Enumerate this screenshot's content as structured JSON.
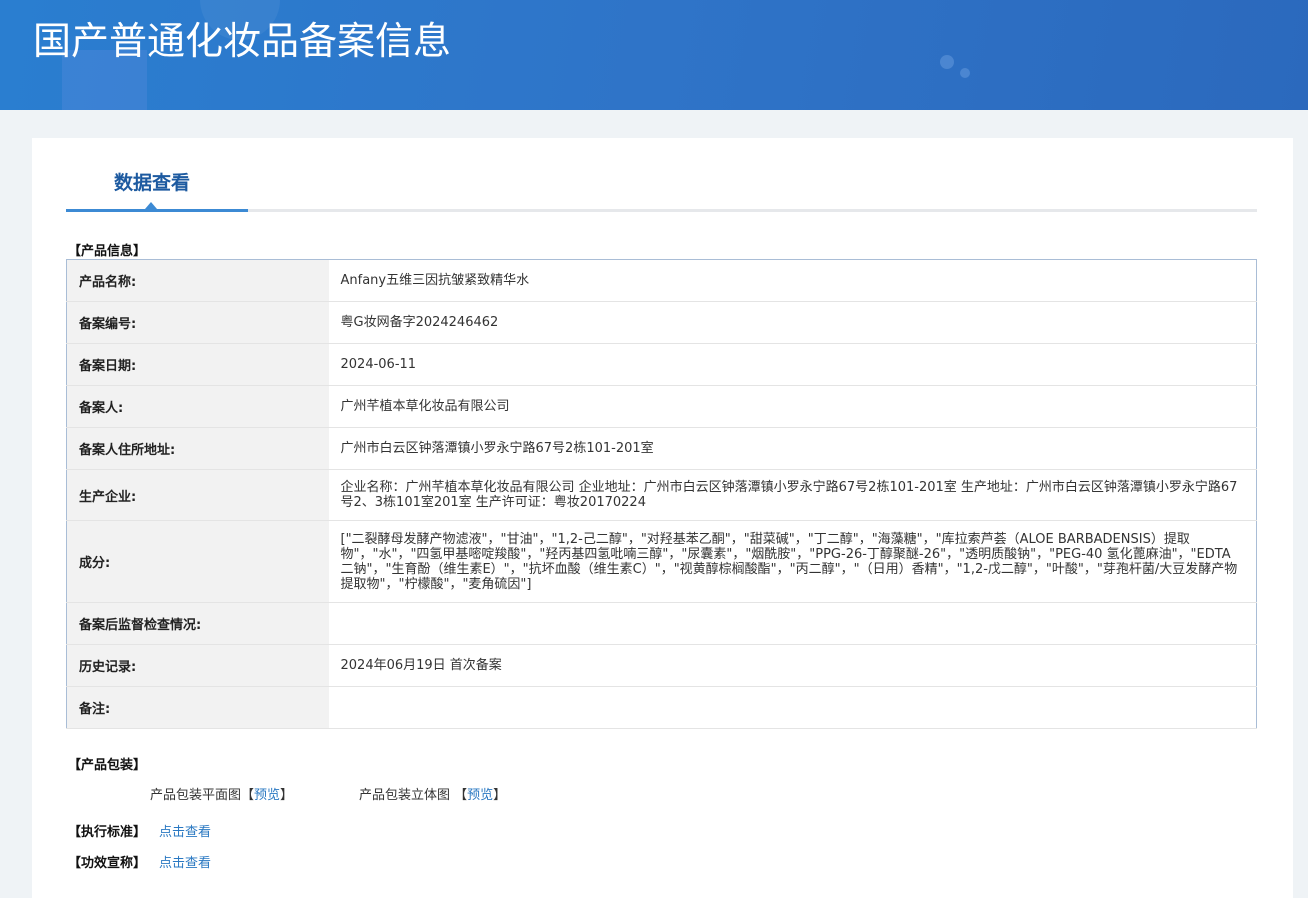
{
  "header": {
    "title": "国产普通化妆品备案信息"
  },
  "tab": {
    "label": "数据查看"
  },
  "product_info": {
    "section": "【产品信息】",
    "rows": [
      {
        "label": "产品名称:",
        "value": "Anfany五维三因抗皱紧致精华水"
      },
      {
        "label": "备案编号:",
        "value": "粤G妆网备字2024246462"
      },
      {
        "label": "备案日期:",
        "value": "2024-06-11"
      },
      {
        "label": "备案人:",
        "value": "广州芊植本草化妆品有限公司"
      },
      {
        "label": "备案人住所地址:",
        "value": "广州市白云区钟落潭镇小罗永宁路67号2栋101-201室"
      },
      {
        "label": "生产企业:",
        "value": "企业名称：广州芊植本草化妆品有限公司 企业地址：广州市白云区钟落潭镇小罗永宁路67号2栋101-201室 生产地址：广州市白云区钟落潭镇小罗永宁路67号2、3栋101室201室 生产许可证：粤妆20170224"
      },
      {
        "label": "成分:",
        "value": "[\"二裂酵母发酵产物滤液\"，\"甘油\"，\"1,2-己二醇\"，\"对羟基苯乙酮\"，\"甜菜碱\"，\"丁二醇\"，\"海藻糖\"，\"库拉索芦荟（ALOE BARBADENSIS）提取物\"，\"水\"，\"四氢甲基嘧啶羧酸\"，\"羟丙基四氢吡喃三醇\"，\"尿囊素\"，\"烟酰胺\"，\"PPG-26-丁醇聚醚-26\"，\"透明质酸钠\"，\"PEG-40 氢化蓖麻油\"，\"EDTA 二钠\"，\"生育酚（维生素E）\"，\"抗坏血酸（维生素C）\"，\"视黄醇棕榈酸酯\"，\"丙二醇\"，\"（日用）香精\"，\"1,2-戊二醇\"，\"叶酸\"，\"芽孢杆菌/大豆发酵产物提取物\"，\"柠檬酸\"，\"麦角硫因\"]"
      },
      {
        "label": "备案后监督检查情况:",
        "value": ""
      },
      {
        "label": "历史记录:",
        "value": "2024年06月19日 首次备案"
      },
      {
        "label": "备注:",
        "value": ""
      }
    ]
  },
  "packaging": {
    "section": "【产品包装】",
    "flat_label": "产品包装平面图",
    "flat_link": "预览",
    "stereo_label": "产品包装立体图",
    "stereo_link": "预览"
  },
  "standard": {
    "section": "【执行标准】",
    "link": "点击查看"
  },
  "efficacy": {
    "section": "【功效宣称】",
    "link": "点击查看"
  }
}
